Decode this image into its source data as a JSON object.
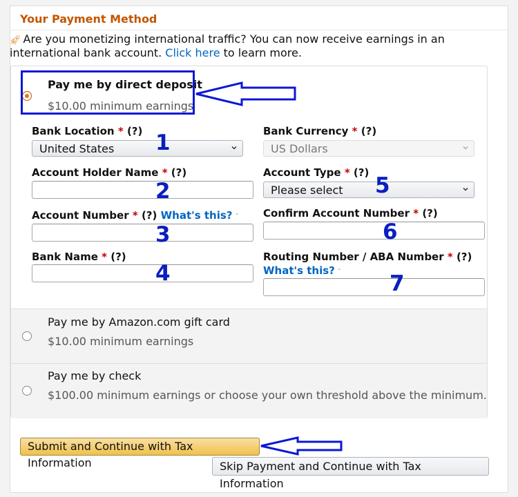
{
  "panel": {
    "title": "Your Payment Method"
  },
  "notice": {
    "text_before_link": "Are you monetizing international traffic? You can now receive earnings in an international bank account. ",
    "link": "Click here",
    "text_after_link": " to learn more."
  },
  "options": {
    "direct_deposit": {
      "label": "Pay me by direct deposit",
      "sub": "$10.00 minimum earnings",
      "selected": true
    },
    "gift_card": {
      "label": "Pay me by Amazon.com gift card",
      "sub": "$10.00 minimum earnings",
      "selected": false
    },
    "check": {
      "label": "Pay me by check",
      "sub": "$100.00 minimum earnings or choose your own threshold above the minimum.",
      "selected": false
    }
  },
  "form": {
    "bank_location": {
      "label": "Bank Location",
      "required": "*",
      "help": "(?)",
      "value": "United States"
    },
    "bank_currency": {
      "label": "Bank Currency",
      "required": "*",
      "help": "(?)",
      "value": "US Dollars"
    },
    "account_holder_name": {
      "label": "Account Holder Name",
      "required": "*",
      "help": "(?)",
      "value": ""
    },
    "account_type": {
      "label": "Account Type",
      "required": "*",
      "help": "(?)",
      "value": "Please select"
    },
    "account_number": {
      "label": "Account Number",
      "required": "*",
      "help": "(?)",
      "whats_this": "What's this?",
      "value": ""
    },
    "confirm_account_number": {
      "label": "Confirm Account Number",
      "required": "*",
      "help": "(?)",
      "value": ""
    },
    "bank_name": {
      "label": "Bank Name",
      "required": "*",
      "help": "(?)",
      "value": ""
    },
    "routing_number": {
      "label": "Routing Number / ABA Number",
      "required": "*",
      "help": "(?)",
      "whats_this": "What's this?",
      "value": ""
    }
  },
  "annotations": {
    "n1": "1",
    "n2": "2",
    "n3": "3",
    "n4": "4",
    "n5": "5",
    "n6": "6",
    "n7": "7",
    "color": "#0b17d6"
  },
  "buttons": {
    "submit": "Submit and Continue with Tax Information",
    "skip": "Skip Payment and Continue with Tax Information"
  },
  "colors": {
    "title": "#c45500",
    "link": "#0066c0",
    "required": "#c40000",
    "primary_button": "#f0c14b"
  }
}
